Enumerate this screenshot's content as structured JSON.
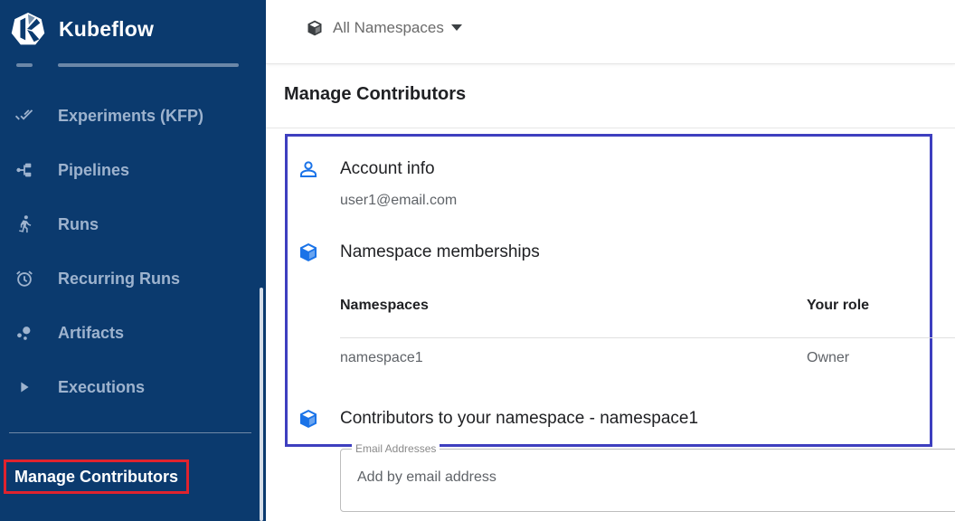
{
  "sidebar": {
    "brand": "Kubeflow",
    "items": [
      {
        "label": "Experiments (KFP)",
        "icon": "done-all-icon"
      },
      {
        "label": "Pipelines",
        "icon": "pipeline-icon"
      },
      {
        "label": "Runs",
        "icon": "directions-run-icon"
      },
      {
        "label": "Recurring Runs",
        "icon": "alarm-icon"
      },
      {
        "label": "Artifacts",
        "icon": "bubble-chart-icon"
      },
      {
        "label": "Executions",
        "icon": "play-arrow-icon"
      }
    ],
    "manage_contributors": "Manage Contributors"
  },
  "topbar": {
    "namespace_selector": "All Namespaces",
    "namespace_icon": "cube-icon"
  },
  "page": {
    "title": "Manage Contributors",
    "account": {
      "heading": "Account info",
      "email": "user1@email.com",
      "icon": "person-outline-icon"
    },
    "memberships": {
      "heading": "Namespace memberships",
      "icon": "cube-icon",
      "columns": [
        "Namespaces",
        "Your role"
      ],
      "rows": [
        {
          "namespace": "namespace1",
          "role": "Owner"
        }
      ]
    },
    "contributors": {
      "heading": "Contributors to your namespace - namespace1",
      "icon": "cube-icon",
      "email_field_label": "Email Addresses",
      "email_placeholder": "Add by email address"
    }
  },
  "colors": {
    "sidebar_bg": "#0b3a6e",
    "sidebar_text": "#9eb3ce",
    "accent_blue": "#1a73e8",
    "highlight_border": "#3e3fbf",
    "annotation_red": "#e0232e"
  }
}
